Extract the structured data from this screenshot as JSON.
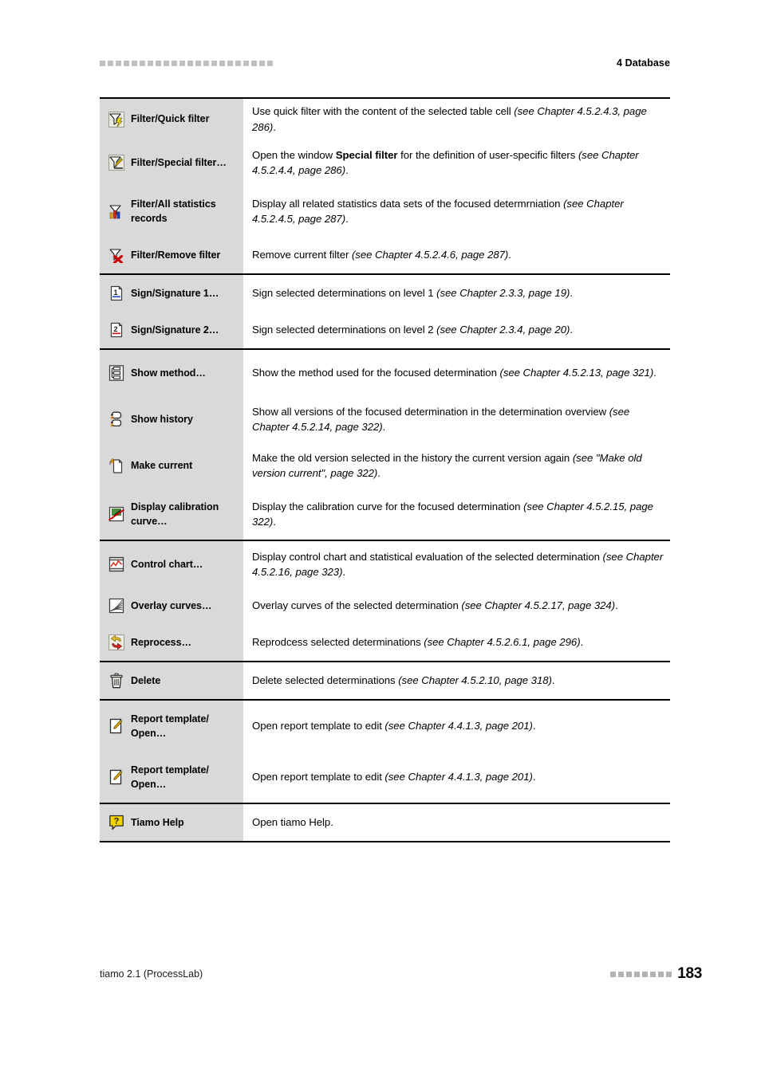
{
  "header": {
    "title": "4 Database",
    "deco_square_count": 22,
    "deco_color": "#c0c0c0"
  },
  "footer": {
    "product": "tiamo 2.1 (ProcessLab)",
    "page_number": "183",
    "deco_square_count": 8,
    "deco_color": "#b3b3b3"
  },
  "table": {
    "icon_column_bg": "#d9d9d9",
    "groups": [
      {
        "rows": [
          {
            "icon": "filter-quick-icon",
            "label": "Filter/Quick filter",
            "desc_plain": "Use quick filter with the content of the selected table cell ",
            "desc_italic": "(see Chapter 4.5.2.4.3, page 286)",
            "desc_tail": "."
          },
          {
            "icon": "filter-special-icon",
            "label": "Filter/Special filter…",
            "desc_plain": "Open the window ",
            "desc_bold": "Special filter",
            "desc_plain2": " for the definition of user-specific filters ",
            "desc_italic": "(see Chapter 4.5.2.4.4, page 286)",
            "desc_tail": "."
          },
          {
            "icon": "filter-all-statistics-icon",
            "label": "Filter/All statistics records",
            "desc_plain": "Display all related statistics data sets of the focused determrniation ",
            "desc_italic": "(see Chapter 4.5.2.4.5, page 287)",
            "desc_tail": "."
          },
          {
            "icon": "filter-remove-icon",
            "label": "Filter/Remove filter",
            "desc_plain": "Remove current filter ",
            "desc_italic": "(see Chapter 4.5.2.4.6, page 287)",
            "desc_tail": "."
          }
        ]
      },
      {
        "rows": [
          {
            "icon": "signature-level-1-icon",
            "label": "Sign/Signature 1…",
            "desc_plain": "Sign selected determinations on level 1 ",
            "desc_italic": "(see Chapter 2.3.3, page 19)",
            "desc_tail": "."
          },
          {
            "icon": "signature-level-2-icon",
            "label": "Sign/Signature 2…",
            "desc_plain": "Sign selected determinations on level 2 ",
            "desc_italic": "(see Chapter 2.3.4, page 20)",
            "desc_tail": "."
          }
        ]
      },
      {
        "rows": [
          {
            "icon": "show-method-icon",
            "label": "Show method…",
            "desc_plain": "Show the method used for the focused determination ",
            "desc_italic": "(see Chapter 4.5.2.13, page 321)",
            "desc_tail": "."
          },
          {
            "icon": "show-history-icon",
            "label": "Show history",
            "desc_plain": "Show all versions of the focused determination in the determination overview ",
            "desc_italic": "(see Chapter 4.5.2.14, page 322)",
            "desc_tail": "."
          },
          {
            "icon": "make-current-icon",
            "label": "Make current",
            "desc_plain": "Make the old version selected in the history the current version again ",
            "desc_italic": "(see \"Make old version current\", page 322)",
            "desc_tail": "."
          },
          {
            "icon": "display-calibration-curve-icon",
            "label": "Display calibration curve…",
            "desc_plain": "Display the calibration curve for the focused determination ",
            "desc_italic": "(see Chapter 4.5.2.15, page 322)",
            "desc_tail": "."
          }
        ]
      },
      {
        "rows": [
          {
            "icon": "control-chart-icon",
            "label": "Control chart…",
            "desc_plain": "Display control chart and statistical evaluation of the selected determination ",
            "desc_italic": "(see Chapter 4.5.2.16, page 323)",
            "desc_tail": "."
          },
          {
            "icon": "overlay-curves-icon",
            "label": "Overlay curves…",
            "desc_plain": "Overlay curves of the selected determination ",
            "desc_italic": "(see Chapter 4.5.2.17, page 324)",
            "desc_tail": "."
          },
          {
            "icon": "reprocess-icon",
            "label": "Reprocess…",
            "desc_plain": "Reprodcess selected determinations ",
            "desc_italic": "(see Chapter 4.5.2.6.1, page 296)",
            "desc_tail": "."
          }
        ]
      },
      {
        "rows": [
          {
            "icon": "delete-icon",
            "label": "Delete",
            "desc_plain": "Delete selected determinations ",
            "desc_italic": "(see Chapter 4.5.2.10, page 318)",
            "desc_tail": "."
          }
        ]
      },
      {
        "rows": [
          {
            "icon": "report-template-open-icon",
            "label": "Report template/ Open…",
            "desc_plain": "Open report template to edit ",
            "desc_italic": "(see Chapter 4.4.1.3, page 201)",
            "desc_tail": "."
          },
          {
            "icon": "report-template-open-icon",
            "label": "Report template/ Open…",
            "desc_plain": "Open report template to edit ",
            "desc_italic": "(see Chapter 4.4.1.3, page 201)",
            "desc_tail": "."
          }
        ]
      },
      {
        "rows": [
          {
            "icon": "tiamo-help-icon",
            "label": "Tiamo Help",
            "desc_plain": "Open tiamo Help.",
            "desc_italic": "",
            "desc_tail": ""
          }
        ]
      }
    ]
  }
}
